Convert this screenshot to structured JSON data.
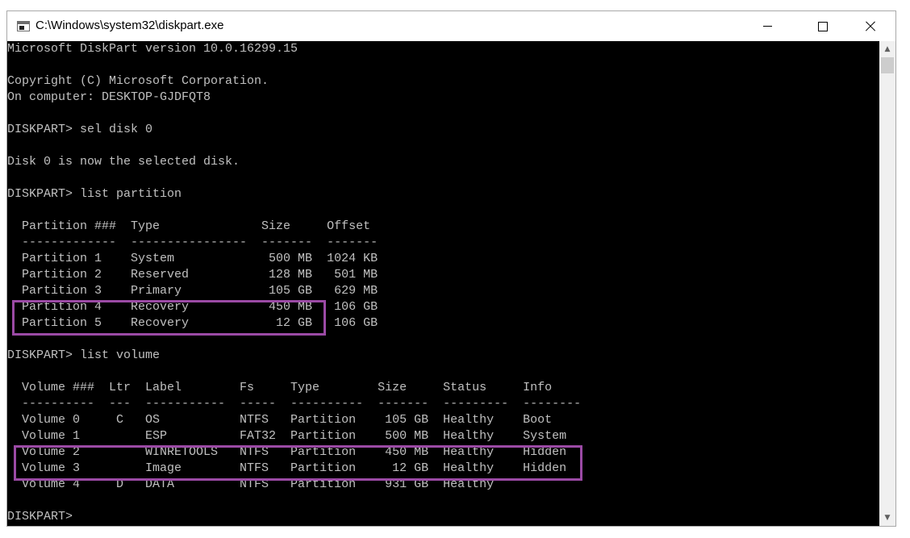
{
  "window": {
    "title": "C:\\Windows\\system32\\diskpart.exe",
    "icons": {
      "app": "console-window-icon",
      "minimize": "minimize-icon",
      "maximize": "maximize-icon",
      "close": "close-icon",
      "scroll_up": "scroll-up-arrow-icon",
      "scroll_down": "scroll-down-arrow-icon"
    }
  },
  "console": {
    "lines": [
      "Microsoft DiskPart version 10.0.16299.15",
      "",
      "Copyright (C) Microsoft Corporation.",
      "On computer: DESKTOP-GJDFQT8",
      "",
      "DISKPART> sel disk 0",
      "",
      "Disk 0 is now the selected disk.",
      "",
      "DISKPART> list partition",
      "",
      "  Partition ###  Type              Size     Offset",
      "  -------------  ----------------  -------  -------",
      "  Partition 1    System             500 MB  1024 KB",
      "  Partition 2    Reserved           128 MB   501 MB",
      "  Partition 3    Primary            105 GB   629 MB",
      "  Partition 4    Recovery           450 MB   106 GB",
      "  Partition 5    Recovery            12 GB   106 GB",
      "",
      "DISKPART> list volume",
      "",
      "  Volume ###  Ltr  Label        Fs     Type        Size     Status     Info",
      "  ----------  ---  -----------  -----  ----------  -------  ---------  --------",
      "  Volume 0     C   OS           NTFS   Partition    105 GB  Healthy    Boot",
      "  Volume 1         ESP          FAT32  Partition    500 MB  Healthy    System",
      "  Volume 2         WINRETOOLS   NTFS   Partition    450 MB  Healthy    Hidden",
      "  Volume 3         Image        NTFS   Partition     12 GB  Healthy    Hidden",
      "  Volume 4     D   DATA         NTFS   Partition    931 GB  Healthy",
      "",
      "DISKPART>"
    ]
  },
  "colors": {
    "console_background": "#000000",
    "console_text": "#c0c0c0",
    "highlight_border": "#9b4aa5",
    "titlebar": "#ffffff"
  }
}
